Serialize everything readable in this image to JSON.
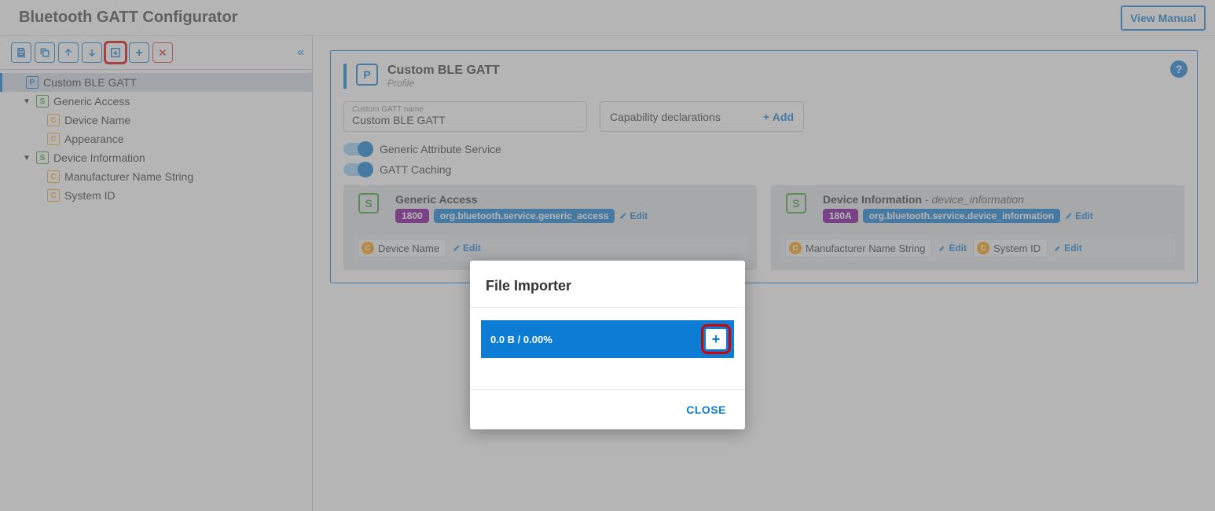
{
  "header": {
    "title": "Bluetooth GATT Configurator",
    "view_manual": "View Manual"
  },
  "sidebar": {
    "tree": {
      "root": "Custom BLE GATT",
      "s1": "Generic Access",
      "s1c1": "Device Name",
      "s1c2": "Appearance",
      "s2": "Device Information",
      "s2c1": "Manufacturer Name String",
      "s2c2": "System ID"
    }
  },
  "profile": {
    "title": "Custom BLE GATT",
    "subtitle": "Profile",
    "name_field_label": "Custom GATT name",
    "name_field_value": "Custom BLE GATT",
    "cap_label": "Capability declarations",
    "add": "Add",
    "toggle1": "Generic Attribute Service",
    "toggle2": "GATT Caching",
    "edit": "Edit"
  },
  "services": [
    {
      "title": "Generic Access",
      "alias": "",
      "uuid": "1800",
      "sig": "org.bluetooth.service.generic_access",
      "chars": [
        {
          "name": "Device Name"
        }
      ]
    },
    {
      "title": "Device Information",
      "alias": "device_information",
      "uuid": "180A",
      "sig": "org.bluetooth.service.device_information",
      "chars": [
        {
          "name": "Manufacturer Name String"
        },
        {
          "name": "System ID"
        }
      ]
    }
  ],
  "dialog": {
    "title": "File Importer",
    "progress": "0.0 B / 0.00%",
    "close": "CLOSE"
  }
}
